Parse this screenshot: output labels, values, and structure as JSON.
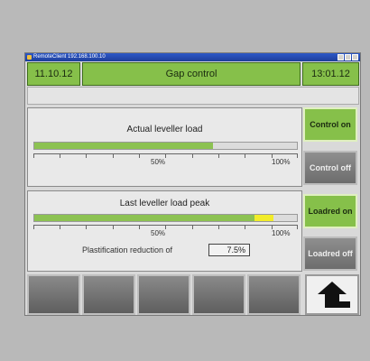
{
  "window": {
    "title": "RemoteClient 192.168.100.10"
  },
  "header": {
    "date": "11.10.12",
    "title": "Gap control",
    "time": "13:01.12"
  },
  "panel1": {
    "title": "Actual leveller load",
    "bar_value_percent": 68,
    "scale_mid": "50%",
    "scale_end": "100%"
  },
  "panel2": {
    "title": "Last leveller load peak",
    "bar_value_percent": 84,
    "peak_extra_percent": 7,
    "scale_mid": "50%",
    "scale_end": "100%",
    "reduction_label": "Plastification reduction of",
    "reduction_value": "7.5%"
  },
  "side_buttons": {
    "control_on": "Control on",
    "control_off": "Control off",
    "loadred_on": "Loadred on",
    "loadred_off": "Loadred off"
  },
  "colors": {
    "accent_green": "#86c04a",
    "peak_yellow": "#f2ec2a"
  },
  "icons": {
    "home": "arrow-up-return-icon"
  }
}
